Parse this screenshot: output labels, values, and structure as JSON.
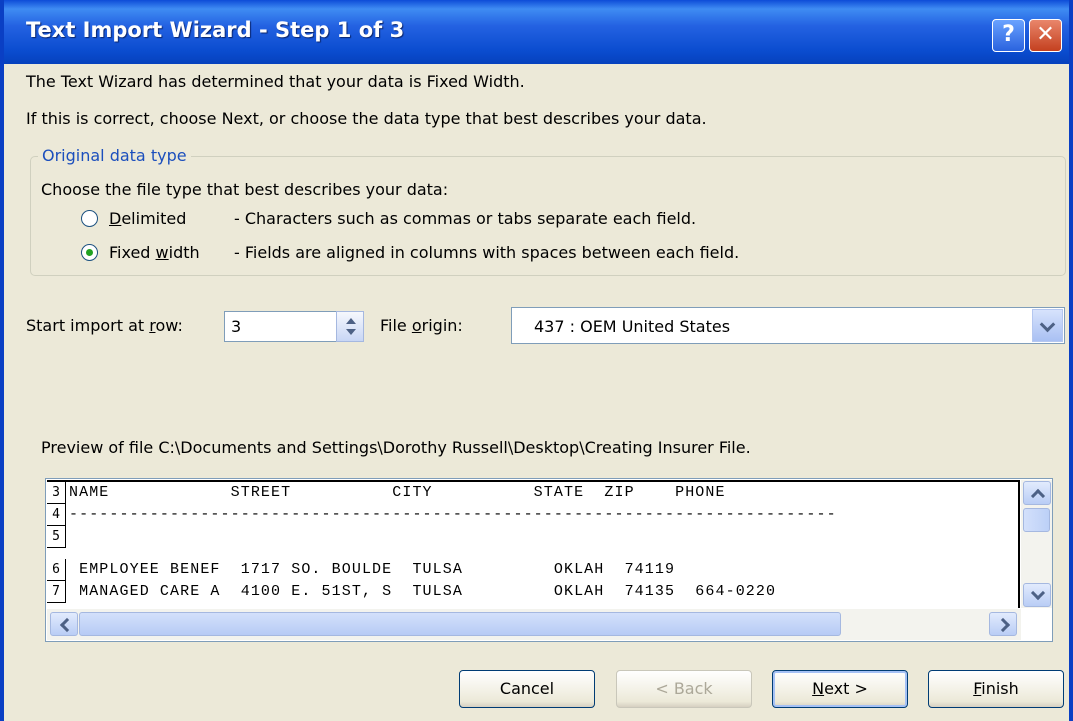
{
  "window": {
    "title": "Text Import Wizard - Step 1 of 3",
    "help_glyph": "?",
    "close_glyph": "✕"
  },
  "intro": {
    "line1": "The Text Wizard has determined that your data is Fixed Width.",
    "line2": "If this is correct, choose Next, or choose the data type that best describes your data."
  },
  "data_type": {
    "group_label": "Original data type",
    "prompt": "Choose the file type that best describes your data:",
    "options": [
      {
        "label_pre": "",
        "label_key": "D",
        "label_post": "elimited",
        "description": "- Characters such as commas or tabs separate each field.",
        "selected": false
      },
      {
        "label_pre": "Fixed ",
        "label_key": "w",
        "label_post": "idth",
        "description": "- Fields are aligned in columns with spaces between each field.",
        "selected": true
      }
    ]
  },
  "start_row": {
    "label_pre": "Start import at ",
    "label_key": "r",
    "label_post": "ow:",
    "value": "3"
  },
  "file_origin": {
    "label_pre": "File ",
    "label_key": "o",
    "label_post": "rigin:",
    "value": "437 : OEM United States"
  },
  "preview": {
    "label": "Preview of file C:\\Documents and Settings\\Dorothy Russell\\Desktop\\Creating Insurer File.",
    "rows": [
      {
        "num": "3",
        "text": "NAME            STREET          CITY          STATE  ZIP    PHONE"
      },
      {
        "num": "4",
        "text": "----------------------------------------------------------------------------"
      },
      {
        "num": "5",
        "text": ""
      },
      {
        "num": "6",
        "text": " EMPLOYEE BENEF  1717 SO. BOULDE  TULSA         OKLAH  74119"
      },
      {
        "num": "7",
        "text": " MANAGED CARE A  4100 E. 51ST, S  TULSA         OKLAH  74135  664-0220"
      }
    ]
  },
  "buttons": {
    "cancel": "Cancel",
    "back": "< Back",
    "next_key": "N",
    "next_rest": "ext >",
    "finish_key": "F",
    "finish_rest": "inish"
  },
  "colors": {
    "title_bar": "#0a4ccf",
    "dialog_bg": "#ece9d8",
    "group_label": "#1c4fbd"
  }
}
